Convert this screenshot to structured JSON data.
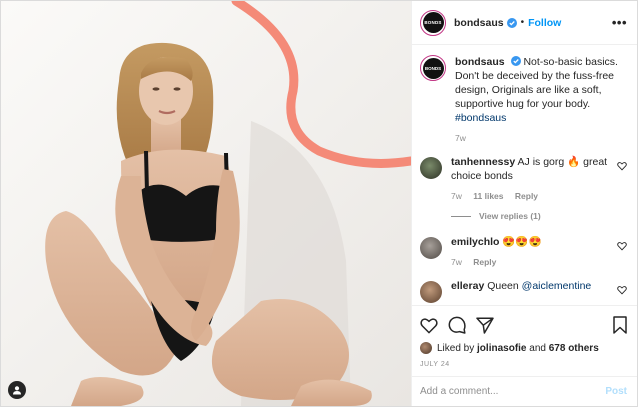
{
  "post": {
    "username": "bondsaus",
    "follow_label": "Follow",
    "more_label": "•••",
    "brand_logo_text": "BONDS"
  },
  "caption": {
    "username": "bondsaus",
    "text": "Not-so-basic basics. Don't be deceived by the fuss-free design, Originals are like a soft, supportive hug for your body.",
    "hashtag": "#bondsaus",
    "time": "7w"
  },
  "comments": [
    {
      "username": "tanhennessy",
      "text": "AJ is gorg 🔥 great choice bonds",
      "time": "7w",
      "likes": "11 likes",
      "reply_label": "Reply",
      "view_replies": "View replies (1)"
    },
    {
      "username": "emilychlo",
      "text": "😍😍😍",
      "time": "7w",
      "reply_label": "Reply"
    },
    {
      "username": "elleray",
      "text": "Queen",
      "mention": "@aiclementine"
    }
  ],
  "likes": {
    "prefix": "Liked by",
    "user": "jolinasofie",
    "and": "and",
    "others": "678 others"
  },
  "date": "JULY 24",
  "add_comment": {
    "placeholder": "Add a comment...",
    "post_label": "Post"
  },
  "colors": {
    "accent": "#0095f6",
    "verified": "#3897f0",
    "wave": "#f48a78"
  }
}
